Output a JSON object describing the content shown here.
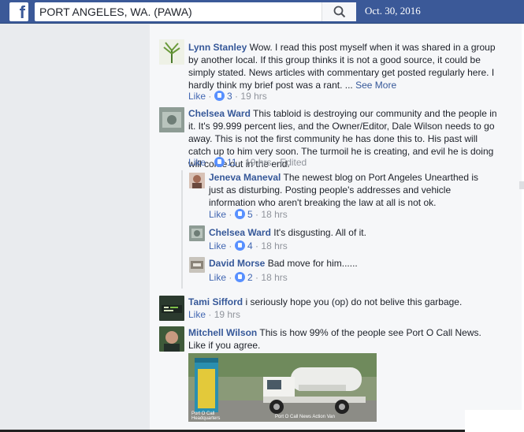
{
  "header": {
    "logo": "f",
    "group_name": "PORT ANGELES, WA. (PAWA)",
    "date": "Oct. 30, 2016"
  },
  "colors": {
    "brand_blue": "#3b5998",
    "link_blue": "#365899",
    "like_blue": "#4267b2",
    "meta_gray": "#90949c"
  },
  "comments": [
    {
      "author": "Lynn Stanley",
      "text": "Wow. I read this post myself when it was shared in a group by another local. If this group thinks it is not a good source, it could be simply stated. News articles with commentary get posted regularly here. I hardly think my brief post was a rant. ...",
      "see_more": "See More",
      "like": "Like",
      "likes": "3",
      "time": "19 hrs"
    },
    {
      "author": "Chelsea Ward",
      "text": "This tabloid is destroying our community and the people in it. It's 99.999 percent lies, and the Owner/Editor, Dale Wilson needs to go away. This is not the first community he has done this to. His past will catch up to him very soon. The turmoil he is creating, and evil he is doing will come out in the end.",
      "like": "Like",
      "likes": "11",
      "time": "19 hrs",
      "edited": "Edited"
    },
    {
      "author": "Jeneva Maneval",
      "text": "The newest blog on Port Angeles Unearthed is just as disturbing. Posting people's addresses and vehicle information who aren't breaking the law at all is not ok.",
      "like": "Like",
      "likes": "5",
      "time": "18 hrs"
    },
    {
      "author": "Chelsea Ward",
      "text": "It's disgusting. All of it.",
      "like": "Like",
      "likes": "4",
      "time": "18 hrs"
    },
    {
      "author": "David Morse",
      "text": "Bad move for him......",
      "like": "Like",
      "likes": "2",
      "time": "18 hrs"
    },
    {
      "author": "Tami Sifford",
      "text": "i seriously hope you (op) do not belive this garbage.",
      "like": "Like",
      "time": "19 hrs"
    },
    {
      "author": "Mitchell Wilson",
      "text": "This is how 99% of the people see Port O Call News. Like if you agree.",
      "image_caption_left": "Port O Call Headquarters",
      "image_caption_right": "Port O Call News Action Van"
    }
  ]
}
